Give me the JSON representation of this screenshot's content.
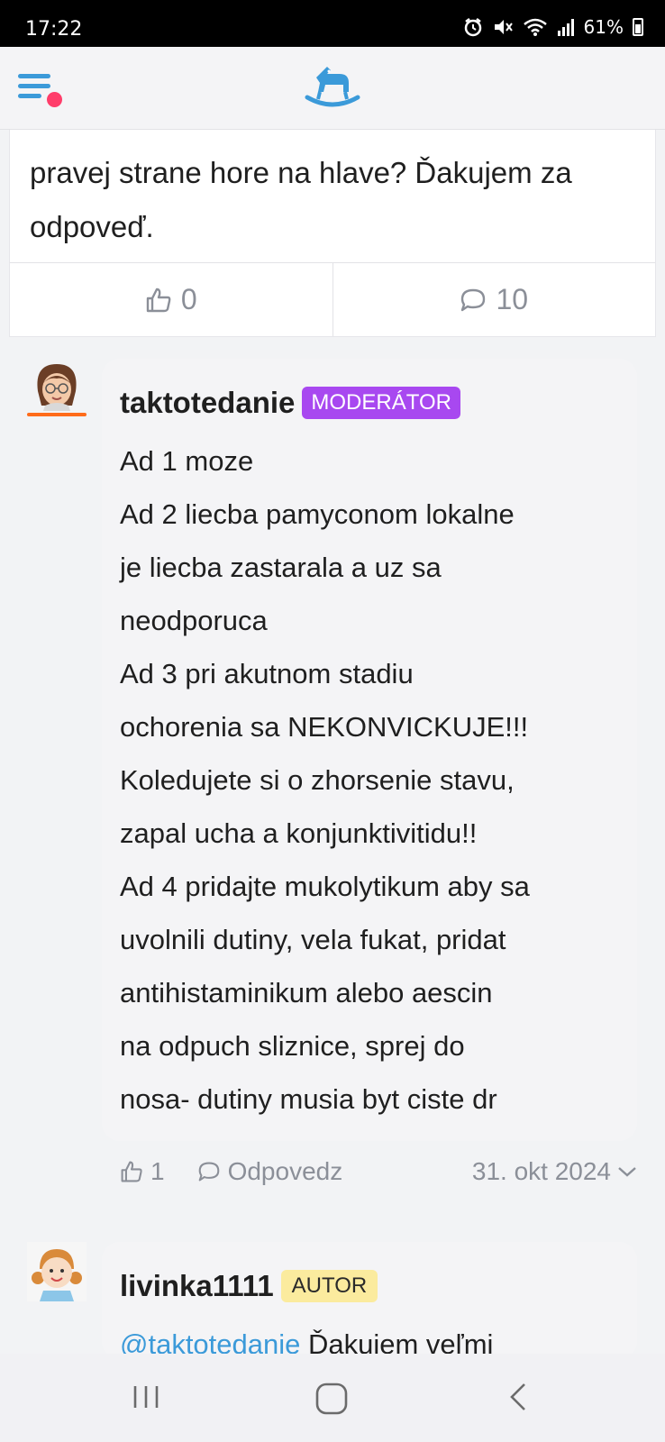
{
  "status": {
    "time": "17:22",
    "battery": "61%"
  },
  "header": {
    "logo": "rocking-horse"
  },
  "post": {
    "text_lines": [
      "pravej strane hore na hlave? Ďakujem za",
      "odpoveď."
    ],
    "likes": "0",
    "comments": "10"
  },
  "comments": [
    {
      "username": "taktotedanie",
      "badge": "MODERÁTOR",
      "lines": [
        "Ad 1 moze",
        "Ad 2 liecba pamyconom lokalne",
        "je liecba zastarala a uz sa",
        "neodporuca",
        "Ad 3 pri akutnom stadiu",
        "ochorenia sa NEKONVICKUJE!!!",
        "Koledujete si o zhorsenie stavu,",
        "zapal ucha a konjunktivitidu!!",
        "Ad 4 pridajte mukolytikum aby sa",
        "uvolnili dutiny, vela fukat, pridat",
        "antihistaminikum alebo aescin",
        "na odpuch sliznice, sprej do",
        "nosa- dutiny musia byt ciste dr"
      ],
      "likes": "1",
      "reply_label": "Odpovedz",
      "date": "31. okt 2024"
    },
    {
      "username": "livinka1111",
      "badge": "AUTOR",
      "mention": "@taktotedanie",
      "text_after_mention": " Ďakujem veľmi"
    }
  ],
  "colors": {
    "accent": "#3b9ad9",
    "notification_dot": "#ff3d6a",
    "moderator_badge": "#a848f0",
    "author_badge": "#fbeb9e",
    "muted": "#8b8f98"
  }
}
